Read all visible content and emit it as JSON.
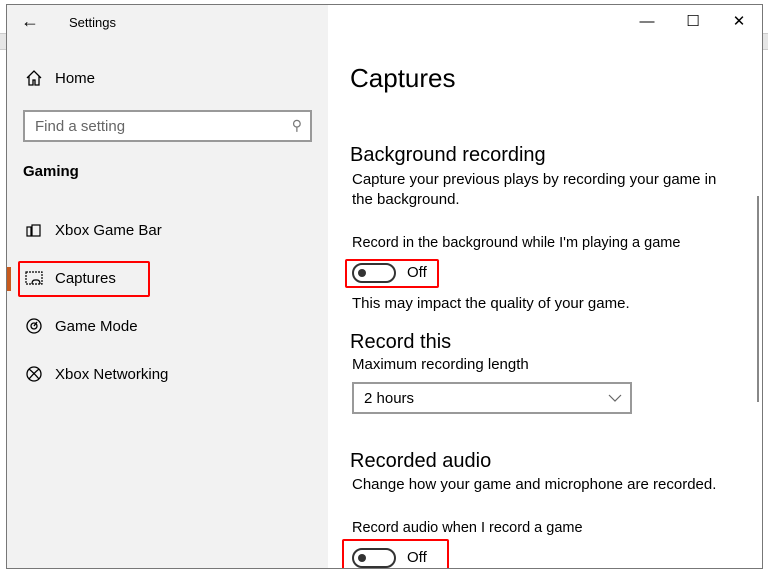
{
  "window": {
    "title": "Settings",
    "minimize": "—",
    "maximize": "☐",
    "close": "✕"
  },
  "sidebar": {
    "home": "Home",
    "search_placeholder": "Find a setting",
    "section": "Gaming",
    "items": [
      {
        "label": "Xbox Game Bar"
      },
      {
        "label": "Captures"
      },
      {
        "label": "Game Mode"
      },
      {
        "label": "Xbox Networking"
      }
    ]
  },
  "main": {
    "title": "Captures",
    "background": {
      "heading": "Background recording",
      "desc_line1": "Capture your previous plays by recording your game in",
      "desc_line2": "the background.",
      "toggle_label": "Record in the background while I'm playing a game",
      "toggle_state": "Off",
      "note": "This may impact the quality of your game."
    },
    "record_this": {
      "heading": "Record this",
      "label": "Maximum recording length",
      "value": "2 hours"
    },
    "audio": {
      "heading": "Recorded audio",
      "desc": "Change how your game and microphone are recorded.",
      "toggle_label": "Record audio when I record a game",
      "toggle_state": "Off"
    }
  },
  "colors": {
    "accent": "#c75a1d",
    "highlight": "#ff0000"
  }
}
